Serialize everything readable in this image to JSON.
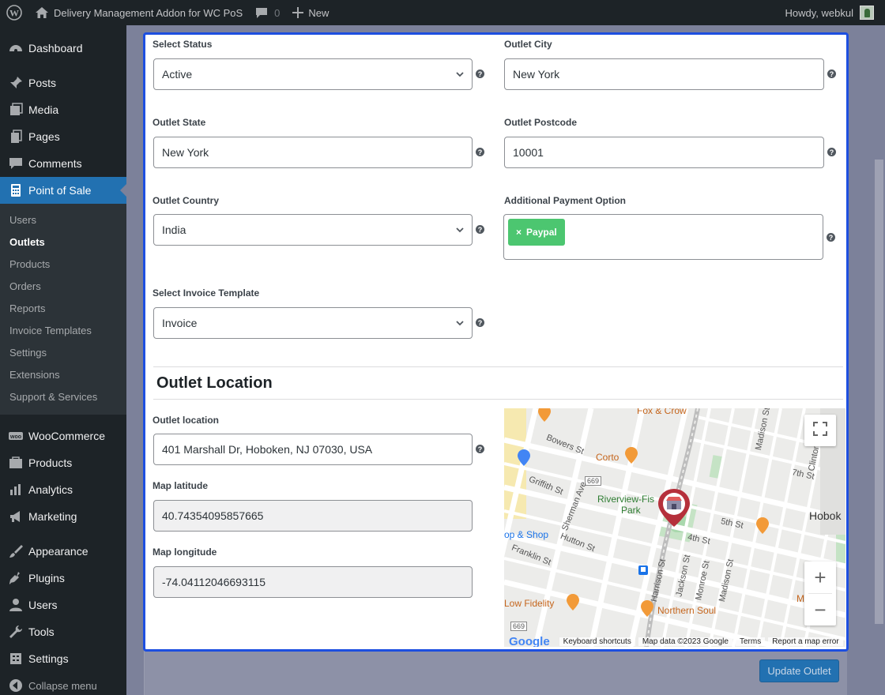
{
  "adminbar": {
    "site_name": "Delivery Management Addon for WC PoS",
    "comments_count": "0",
    "new_label": "New",
    "greeting": "Howdy, webkul"
  },
  "sidebar": {
    "items": [
      {
        "label": "Dashboard",
        "icon": "dashboard-icon"
      },
      {
        "label": "Posts",
        "icon": "pin-icon"
      },
      {
        "label": "Media",
        "icon": "media-icon"
      },
      {
        "label": "Pages",
        "icon": "pages-icon"
      },
      {
        "label": "Comments",
        "icon": "comment-icon"
      },
      {
        "label": "Point of Sale",
        "icon": "calculator-icon"
      }
    ],
    "submenu": [
      "Users",
      "Outlets",
      "Products",
      "Orders",
      "Reports",
      "Invoice Templates",
      "Settings",
      "Extensions",
      "Support & Services"
    ],
    "items2": [
      {
        "label": "WooCommerce",
        "icon": "woo-icon"
      },
      {
        "label": "Products",
        "icon": "products-icon"
      },
      {
        "label": "Analytics",
        "icon": "analytics-icon"
      },
      {
        "label": "Marketing",
        "icon": "megaphone-icon"
      }
    ],
    "items3": [
      {
        "label": "Appearance",
        "icon": "brush-icon"
      },
      {
        "label": "Plugins",
        "icon": "plug-icon"
      },
      {
        "label": "Users",
        "icon": "user-icon"
      },
      {
        "label": "Tools",
        "icon": "wrench-icon"
      },
      {
        "label": "Settings",
        "icon": "settings-icon"
      }
    ],
    "collapse_label": "Collapse menu"
  },
  "form": {
    "status": {
      "label": "Select Status",
      "value": "Active"
    },
    "city": {
      "label": "Outlet City",
      "value": "New York"
    },
    "state": {
      "label": "Outlet State",
      "value": "New York"
    },
    "postcode": {
      "label": "Outlet Postcode",
      "value": "10001"
    },
    "country": {
      "label": "Outlet Country",
      "value": "India"
    },
    "payment": {
      "label": "Additional Payment Option",
      "tag": "Paypal",
      "tag_remove": "×"
    },
    "invoice": {
      "label": "Select Invoice Template",
      "value": "Invoice"
    },
    "help_glyph": "?"
  },
  "location": {
    "section_title": "Outlet Location",
    "address": {
      "label": "Outlet location",
      "value": "401 Marshall Dr, Hoboken, NJ 07030, USA"
    },
    "latitude": {
      "label": "Map latitude",
      "value": "40.74354095857665"
    },
    "longitude": {
      "label": "Map longitude",
      "value": "-74.04112046693115"
    }
  },
  "map": {
    "labels": {
      "fox_crow": "Fox & Crow",
      "bowers": "Bowers St",
      "corto": "Corto",
      "griffith": "Griffith St",
      "route": "669",
      "sherman": "Sherman Ave",
      "riverview": "Riverview-Fis",
      "park": "Park",
      "stop_shop": "op & Shop",
      "hutton": "Hutton St",
      "franklin": "Franklin St",
      "fifth": "5th St",
      "fourth": "4th St",
      "seventh": "7th St",
      "clinton": "Clinton St",
      "madison": "Madison St",
      "hobok": "Hobok",
      "harrison": "Harrison St",
      "jackson": "Jackson St",
      "monroe": "Monroe St",
      "low_fidelity": "Low Fidelity",
      "northern_soul": "Northern Soul",
      "mamo": "Mamo",
      "route_bottom": "669"
    },
    "footer": {
      "google": "Google",
      "shortcuts": "Keyboard shortcuts",
      "data": "Map data ©2023 Google",
      "terms": "Terms",
      "report": "Report a map error"
    },
    "zoom_in": "+",
    "zoom_out": "−"
  },
  "actions": {
    "update_label": "Update Outlet"
  },
  "colors": {
    "accent": "#2271b1",
    "tag": "#4cc670",
    "card_border": "#1d4fe0",
    "marker": "#b5303b"
  }
}
